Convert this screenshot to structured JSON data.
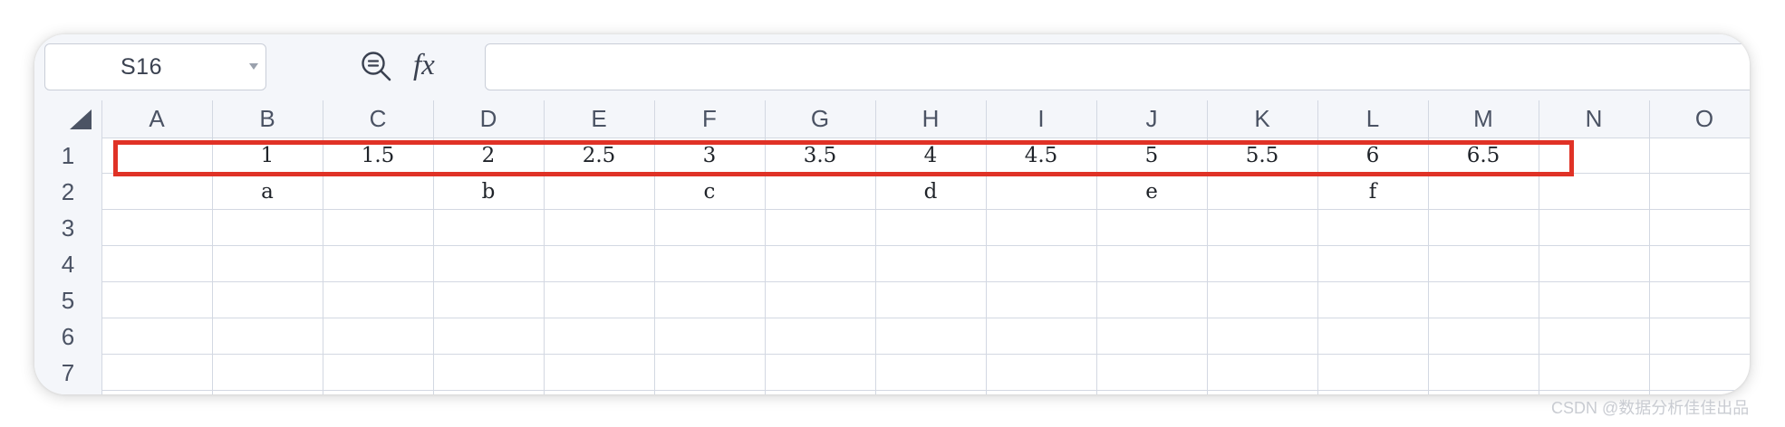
{
  "formula_bar": {
    "name_box_value": "S16",
    "zoom_icon": "zoom-out-magnifier-icon",
    "fx_label": "fx",
    "formula_value": ""
  },
  "columns": [
    "A",
    "B",
    "C",
    "D",
    "E",
    "F",
    "G",
    "H",
    "I",
    "J",
    "K",
    "L",
    "M",
    "N",
    "O"
  ],
  "rows": [
    "1",
    "2",
    "3",
    "4",
    "5",
    "6",
    "7"
  ],
  "cells": {
    "row1": [
      "",
      "1",
      "1.5",
      "2",
      "2.5",
      "3",
      "3.5",
      "4",
      "4.5",
      "5",
      "5.5",
      "6",
      "6.5",
      "",
      ""
    ],
    "row2": [
      "",
      "a",
      "",
      "b",
      "",
      "c",
      "",
      "d",
      "",
      "e",
      "",
      "f",
      "",
      "",
      ""
    ]
  },
  "highlight_color": "#e03226",
  "watermark": "CSDN @数据分析佳佳出品"
}
